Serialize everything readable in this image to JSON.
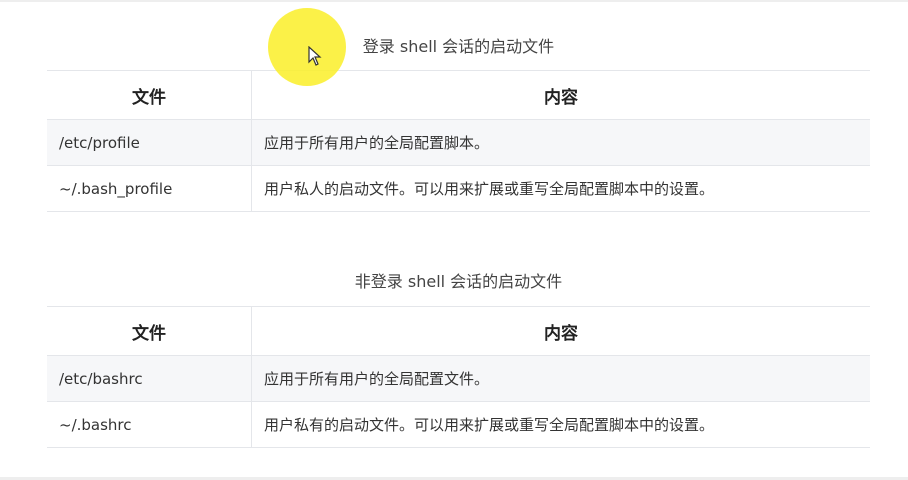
{
  "login_table": {
    "caption": "登录 shell 会话的启动文件",
    "headers": [
      "文件",
      "内容"
    ],
    "rows": [
      [
        "/etc/profile",
        "应用于所有用户的全局配置脚本。"
      ],
      [
        "~/.bash_profile",
        "用户私人的启动文件。可以用来扩展或重写全局配置脚本中的设置。"
      ]
    ]
  },
  "nonlogin_table": {
    "caption": "非登录 shell 会话的启动文件",
    "headers": [
      "文件",
      "内容"
    ],
    "rows": [
      [
        "/etc/bashrc",
        "应用于所有用户的全局配置文件。"
      ],
      [
        "~/.bashrc",
        "用户私有的启动文件。可以用来扩展或重写全局配置脚本中的设置。"
      ]
    ]
  },
  "cursor": {
    "icon": "arrow-pointer-icon",
    "highlight_color": "#f9ec28"
  }
}
